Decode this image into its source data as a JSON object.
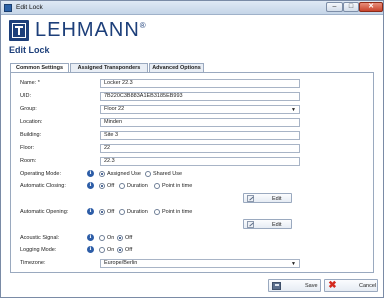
{
  "window": {
    "title": "Edit Lock",
    "minimize": "–",
    "maximize": "□",
    "close": "✕"
  },
  "logo": {
    "text": "LEHMANN",
    "mark": "®"
  },
  "page_title": "Edit Lock",
  "tabs": [
    "Common Settings",
    "Assigned Transponders",
    "Advanced Options"
  ],
  "form": {
    "name": {
      "label": "Name: *",
      "value": "Locker 22.3"
    },
    "uid": {
      "label": "UID:",
      "value": "7B220C3B883A1EB3185EB993"
    },
    "group": {
      "label": "Group:",
      "value": "Floor 22"
    },
    "location": {
      "label": "Location:",
      "value": "Minden"
    },
    "building": {
      "label": "Building:",
      "value": "Site 3"
    },
    "floor": {
      "label": "Floor:",
      "value": "22"
    },
    "room": {
      "label": "Room:",
      "value": "22.3"
    },
    "operating_mode": {
      "label": "Operating Mode:",
      "options": [
        "Assigned Use",
        "Shared Use"
      ],
      "selected": "Assigned Use"
    },
    "automatic_closing": {
      "label": "Automatic Closing:",
      "options": [
        "Off",
        "Duration",
        "Point in time"
      ],
      "selected": "Off",
      "edit": "Edit"
    },
    "automatic_opening": {
      "label": "Automatic Opening:",
      "options": [
        "Off",
        "Duration",
        "Point in time"
      ],
      "selected": "Off",
      "edit": "Edit"
    },
    "acoustic_signal": {
      "label": "Acoustic Signal:",
      "options": [
        "On",
        "Off"
      ],
      "selected": "Off"
    },
    "logging_mode": {
      "label": "Logging Mode:",
      "options": [
        "On",
        "Off"
      ],
      "selected": "Off"
    },
    "timezone": {
      "label": "Timezone:",
      "value": "Europe/Berlin"
    }
  },
  "info_icon_glyph": "i",
  "select_arrow": "▼",
  "footer": {
    "save": "Save",
    "cancel": "Cancel",
    "cancel_glyph": "✖"
  },
  "colors": {
    "brand": "#1d3f7a",
    "accent": "#2d5da7",
    "cancel_red": "#d42a1f"
  },
  "icons": [
    "app-icon",
    "info-icon",
    "edit-pencil-icon",
    "save-floppy-icon",
    "cancel-x-icon",
    "chevron-down-icon"
  ]
}
